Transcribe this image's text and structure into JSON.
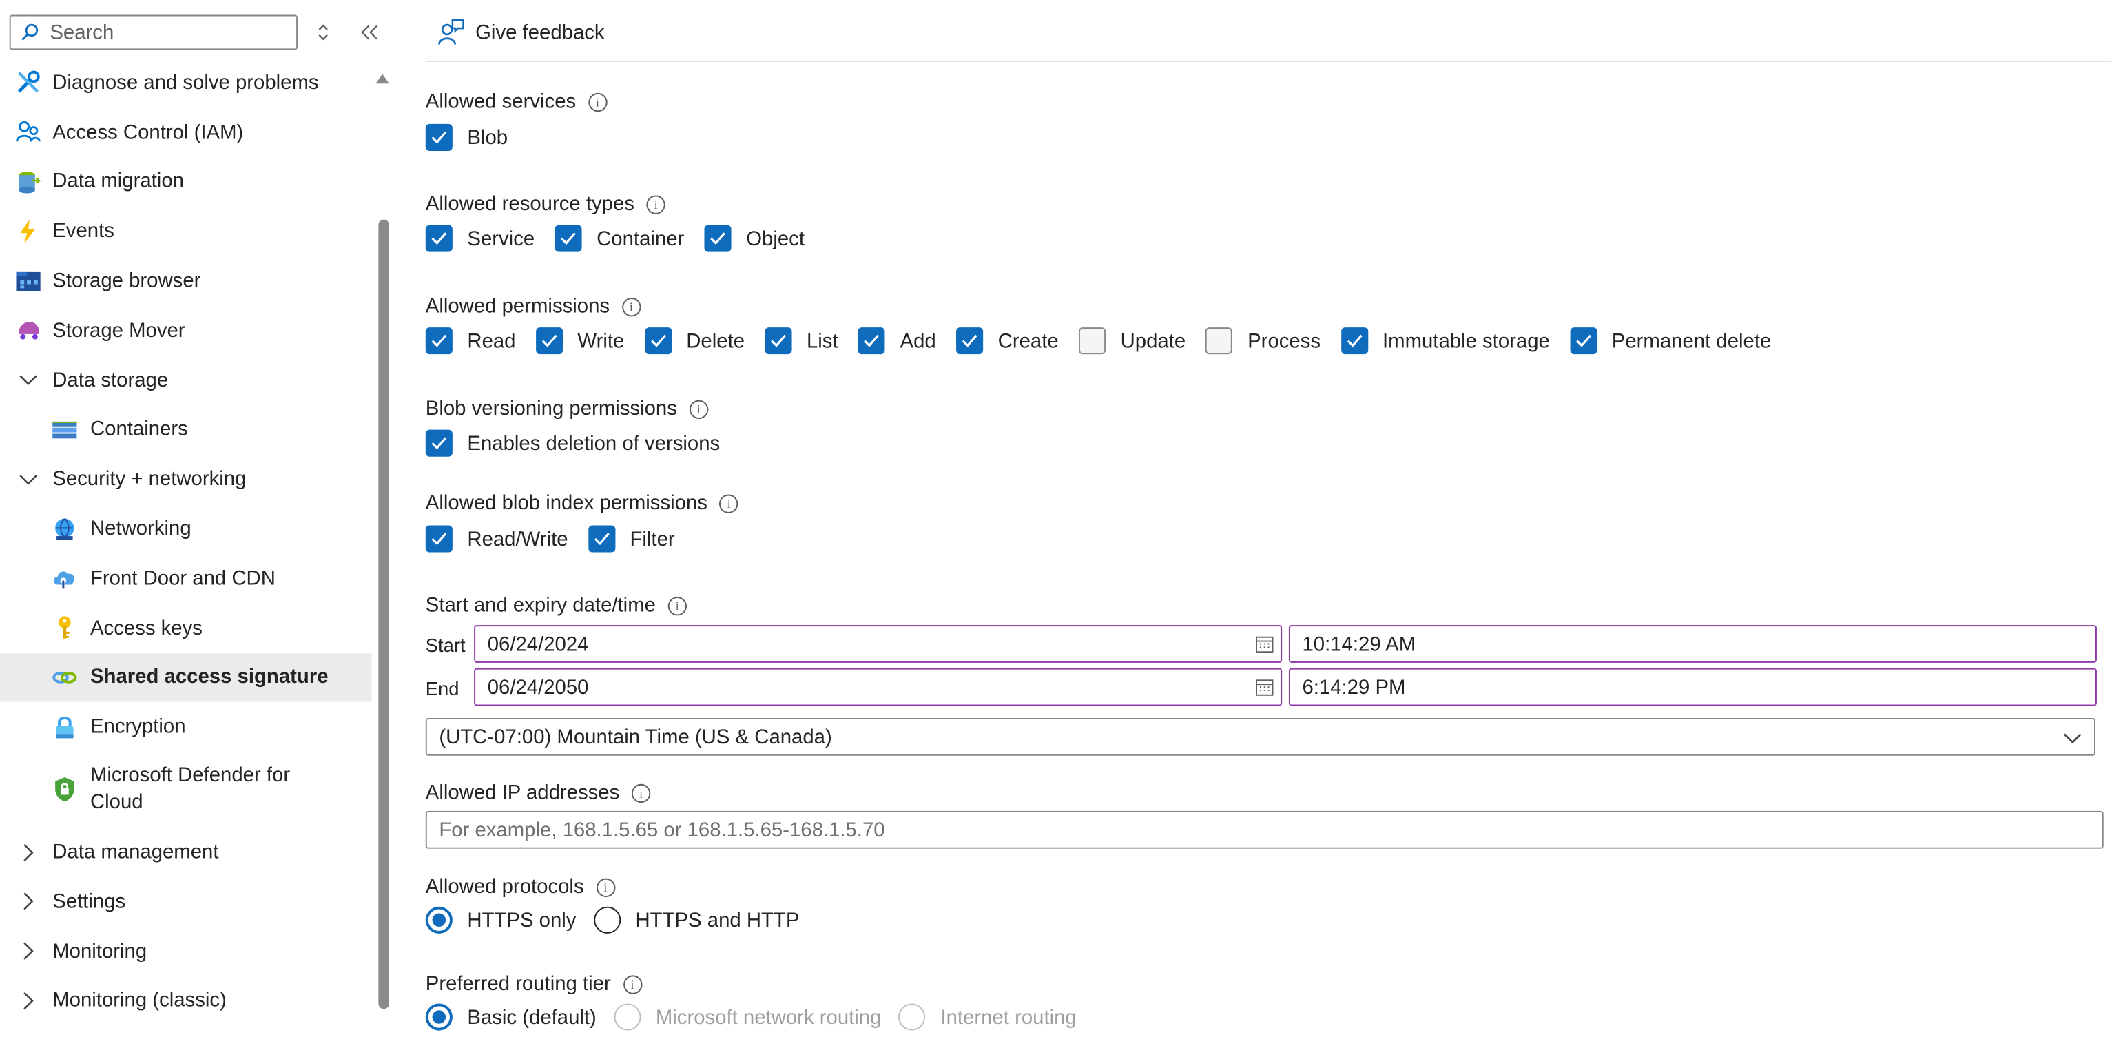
{
  "sidebar": {
    "search_placeholder": "Search",
    "items": [
      {
        "label": "Diagnose and solve problems",
        "icon": "wrench-screwdriver-icon"
      },
      {
        "label": "Access Control (IAM)",
        "icon": "people-icon"
      },
      {
        "label": "Data migration",
        "icon": "data-migration-icon"
      },
      {
        "label": "Events",
        "icon": "lightning-icon"
      },
      {
        "label": "Storage browser",
        "icon": "storage-browser-icon"
      },
      {
        "label": "Storage Mover",
        "icon": "storage-mover-icon"
      },
      {
        "label": "Data storage",
        "icon": "chevron-down-icon"
      },
      {
        "label": "Containers",
        "icon": "containers-icon"
      },
      {
        "label": "Security + networking",
        "icon": "chevron-down-icon"
      },
      {
        "label": "Networking",
        "icon": "networking-icon"
      },
      {
        "label": "Front Door and CDN",
        "icon": "cloud-icon"
      },
      {
        "label": "Access keys",
        "icon": "key-icon"
      },
      {
        "label": "Shared access signature",
        "icon": "link-icon"
      },
      {
        "label": "Encryption",
        "icon": "lock-icon"
      },
      {
        "label": "Microsoft Defender for Cloud",
        "icon": "shield-icon"
      },
      {
        "label": "Data management",
        "icon": "chevron-right-icon"
      },
      {
        "label": "Settings",
        "icon": "chevron-right-icon"
      },
      {
        "label": "Monitoring",
        "icon": "chevron-right-icon"
      },
      {
        "label": "Monitoring (classic)",
        "icon": "chevron-right-icon"
      }
    ],
    "selected": "Shared access signature"
  },
  "toolbar": {
    "feedback_label": "Give feedback"
  },
  "form": {
    "allowed_services": {
      "label": "Allowed services",
      "options": [
        {
          "label": "Blob",
          "checked": true
        }
      ]
    },
    "resource_types": {
      "label": "Allowed resource types",
      "options": [
        {
          "label": "Service",
          "checked": true
        },
        {
          "label": "Container",
          "checked": true
        },
        {
          "label": "Object",
          "checked": true
        }
      ]
    },
    "permissions": {
      "label": "Allowed permissions",
      "options": [
        {
          "label": "Read",
          "checked": true
        },
        {
          "label": "Write",
          "checked": true
        },
        {
          "label": "Delete",
          "checked": true
        },
        {
          "label": "List",
          "checked": true
        },
        {
          "label": "Add",
          "checked": true
        },
        {
          "label": "Create",
          "checked": true
        },
        {
          "label": "Update",
          "checked": false
        },
        {
          "label": "Process",
          "checked": false
        },
        {
          "label": "Immutable storage",
          "checked": true
        },
        {
          "label": "Permanent delete",
          "checked": true
        }
      ]
    },
    "blob_versioning": {
      "label": "Blob versioning permissions",
      "options": [
        {
          "label": "Enables deletion of versions",
          "checked": true
        }
      ]
    },
    "blob_index": {
      "label": "Allowed blob index permissions",
      "options": [
        {
          "label": "Read/Write",
          "checked": true
        },
        {
          "label": "Filter",
          "checked": true
        }
      ]
    },
    "datetime": {
      "label": "Start and expiry date/time",
      "start_label": "Start",
      "start_date": "06/24/2024",
      "start_time": "10:14:29 AM",
      "end_label": "End",
      "end_date": "06/24/2050",
      "end_time": "6:14:29 PM",
      "timezone": "(UTC-07:00) Mountain Time (US & Canada)"
    },
    "ip": {
      "label": "Allowed IP addresses",
      "placeholder": "For example, 168.1.5.65 or 168.1.5.65-168.1.5.70"
    },
    "protocols": {
      "label": "Allowed protocols",
      "options": [
        {
          "label": "HTTPS only",
          "selected": true
        },
        {
          "label": "HTTPS and HTTP",
          "selected": false
        }
      ]
    },
    "routing": {
      "label": "Preferred routing tier",
      "options": [
        {
          "label": "Basic (default)",
          "selected": true
        },
        {
          "label": "Microsoft network routing",
          "selected": false,
          "disabled": true
        },
        {
          "label": "Internet routing",
          "selected": false,
          "disabled": true
        }
      ]
    }
  },
  "colors": {
    "accent": "#0f6cbd",
    "field_border_focus": "#8f3aa8",
    "selected_bg": "#ebebeb"
  }
}
